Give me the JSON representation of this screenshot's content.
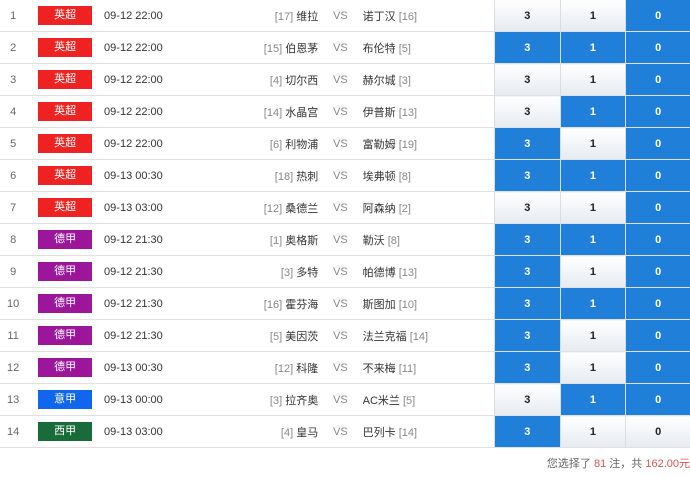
{
  "matches": [
    {
      "no": "1",
      "league": "英超",
      "league_color": "#ee2222",
      "time": "09-12 22:00",
      "home_rank": "[17]",
      "home": "维拉",
      "vs": "VS",
      "away": "诺丁汉",
      "away_rank": "[16]",
      "odds": [
        {
          "value": "3",
          "selected": false
        },
        {
          "value": "1",
          "selected": false
        },
        {
          "value": "0",
          "selected": true
        }
      ]
    },
    {
      "no": "2",
      "league": "英超",
      "league_color": "#ee2222",
      "time": "09-12 22:00",
      "home_rank": "[15]",
      "home": "伯恩茅",
      "vs": "VS",
      "away": "布伦特",
      "away_rank": "[5]",
      "odds": [
        {
          "value": "3",
          "selected": true
        },
        {
          "value": "1",
          "selected": true
        },
        {
          "value": "0",
          "selected": true
        }
      ]
    },
    {
      "no": "3",
      "league": "英超",
      "league_color": "#ee2222",
      "time": "09-12 22:00",
      "home_rank": "[4]",
      "home": "切尔西",
      "vs": "VS",
      "away": "赫尔城",
      "away_rank": "[3]",
      "odds": [
        {
          "value": "3",
          "selected": false
        },
        {
          "value": "1",
          "selected": false
        },
        {
          "value": "0",
          "selected": true
        }
      ]
    },
    {
      "no": "4",
      "league": "英超",
      "league_color": "#ee2222",
      "time": "09-12 22:00",
      "home_rank": "[14]",
      "home": "水晶宫",
      "vs": "VS",
      "away": "伊普斯",
      "away_rank": "[13]",
      "odds": [
        {
          "value": "3",
          "selected": false
        },
        {
          "value": "1",
          "selected": true
        },
        {
          "value": "0",
          "selected": true
        }
      ]
    },
    {
      "no": "5",
      "league": "英超",
      "league_color": "#ee2222",
      "time": "09-12 22:00",
      "home_rank": "[6]",
      "home": "利物浦",
      "vs": "VS",
      "away": "富勒姆",
      "away_rank": "[19]",
      "odds": [
        {
          "value": "3",
          "selected": true
        },
        {
          "value": "1",
          "selected": false
        },
        {
          "value": "0",
          "selected": true
        }
      ]
    },
    {
      "no": "6",
      "league": "英超",
      "league_color": "#ee2222",
      "time": "09-13 00:30",
      "home_rank": "[18]",
      "home": "热刺",
      "vs": "VS",
      "away": "埃弗顿",
      "away_rank": "[8]",
      "odds": [
        {
          "value": "3",
          "selected": true
        },
        {
          "value": "1",
          "selected": true
        },
        {
          "value": "0",
          "selected": true
        }
      ]
    },
    {
      "no": "7",
      "league": "英超",
      "league_color": "#ee2222",
      "time": "09-13 03:00",
      "home_rank": "[12]",
      "home": "桑德兰",
      "vs": "VS",
      "away": "阿森纳",
      "away_rank": "[2]",
      "odds": [
        {
          "value": "3",
          "selected": false
        },
        {
          "value": "1",
          "selected": false
        },
        {
          "value": "0",
          "selected": true
        }
      ]
    },
    {
      "no": "8",
      "league": "德甲",
      "league_color": "#9b169b",
      "time": "09-12 21:30",
      "home_rank": "[1]",
      "home": "奥格斯",
      "vs": "VS",
      "away": "勒沃",
      "away_rank": "[8]",
      "odds": [
        {
          "value": "3",
          "selected": true
        },
        {
          "value": "1",
          "selected": true
        },
        {
          "value": "0",
          "selected": true
        }
      ]
    },
    {
      "no": "9",
      "league": "德甲",
      "league_color": "#9b169b",
      "time": "09-12 21:30",
      "home_rank": "[3]",
      "home": "多特",
      "vs": "VS",
      "away": "帕德博",
      "away_rank": "[13]",
      "odds": [
        {
          "value": "3",
          "selected": true
        },
        {
          "value": "1",
          "selected": false
        },
        {
          "value": "0",
          "selected": true
        }
      ]
    },
    {
      "no": "10",
      "league": "德甲",
      "league_color": "#9b169b",
      "time": "09-12 21:30",
      "home_rank": "[16]",
      "home": "霍芬海",
      "vs": "VS",
      "away": "斯图加",
      "away_rank": "[10]",
      "odds": [
        {
          "value": "3",
          "selected": true
        },
        {
          "value": "1",
          "selected": true
        },
        {
          "value": "0",
          "selected": true
        }
      ]
    },
    {
      "no": "11",
      "league": "德甲",
      "league_color": "#9b169b",
      "time": "09-12 21:30",
      "home_rank": "[5]",
      "home": "美因茨",
      "vs": "VS",
      "away": "法兰克福",
      "away_rank": "[14]",
      "odds": [
        {
          "value": "3",
          "selected": true
        },
        {
          "value": "1",
          "selected": false
        },
        {
          "value": "0",
          "selected": true
        }
      ]
    },
    {
      "no": "12",
      "league": "德甲",
      "league_color": "#9b169b",
      "time": "09-13 00:30",
      "home_rank": "[12]",
      "home": "科隆",
      "vs": "VS",
      "away": "不来梅",
      "away_rank": "[11]",
      "odds": [
        {
          "value": "3",
          "selected": true
        },
        {
          "value": "1",
          "selected": false
        },
        {
          "value": "0",
          "selected": true
        }
      ]
    },
    {
      "no": "13",
      "league": "意甲",
      "league_color": "#1166ee",
      "time": "09-13 00:00",
      "home_rank": "[3]",
      "home": "拉齐奥",
      "vs": "VS",
      "away": "AC米兰",
      "away_rank": "[5]",
      "odds": [
        {
          "value": "3",
          "selected": false
        },
        {
          "value": "1",
          "selected": true
        },
        {
          "value": "0",
          "selected": true
        }
      ]
    },
    {
      "no": "14",
      "league": "西甲",
      "league_color": "#1a6b3a",
      "time": "09-13 03:00",
      "home_rank": "[4]",
      "home": "皇马",
      "vs": "VS",
      "away": "巴列卡",
      "away_rank": "[14]",
      "odds": [
        {
          "value": "3",
          "selected": true
        },
        {
          "value": "1",
          "selected": false
        },
        {
          "value": "0",
          "selected": false
        }
      ]
    }
  ],
  "summary": {
    "prefix": "您选择了",
    "bets": "81",
    "middle": "注，共",
    "amount": "162.00元"
  },
  "colors": {
    "selected_bg": "#1f7fd9",
    "amount_red": "#d9534f"
  }
}
